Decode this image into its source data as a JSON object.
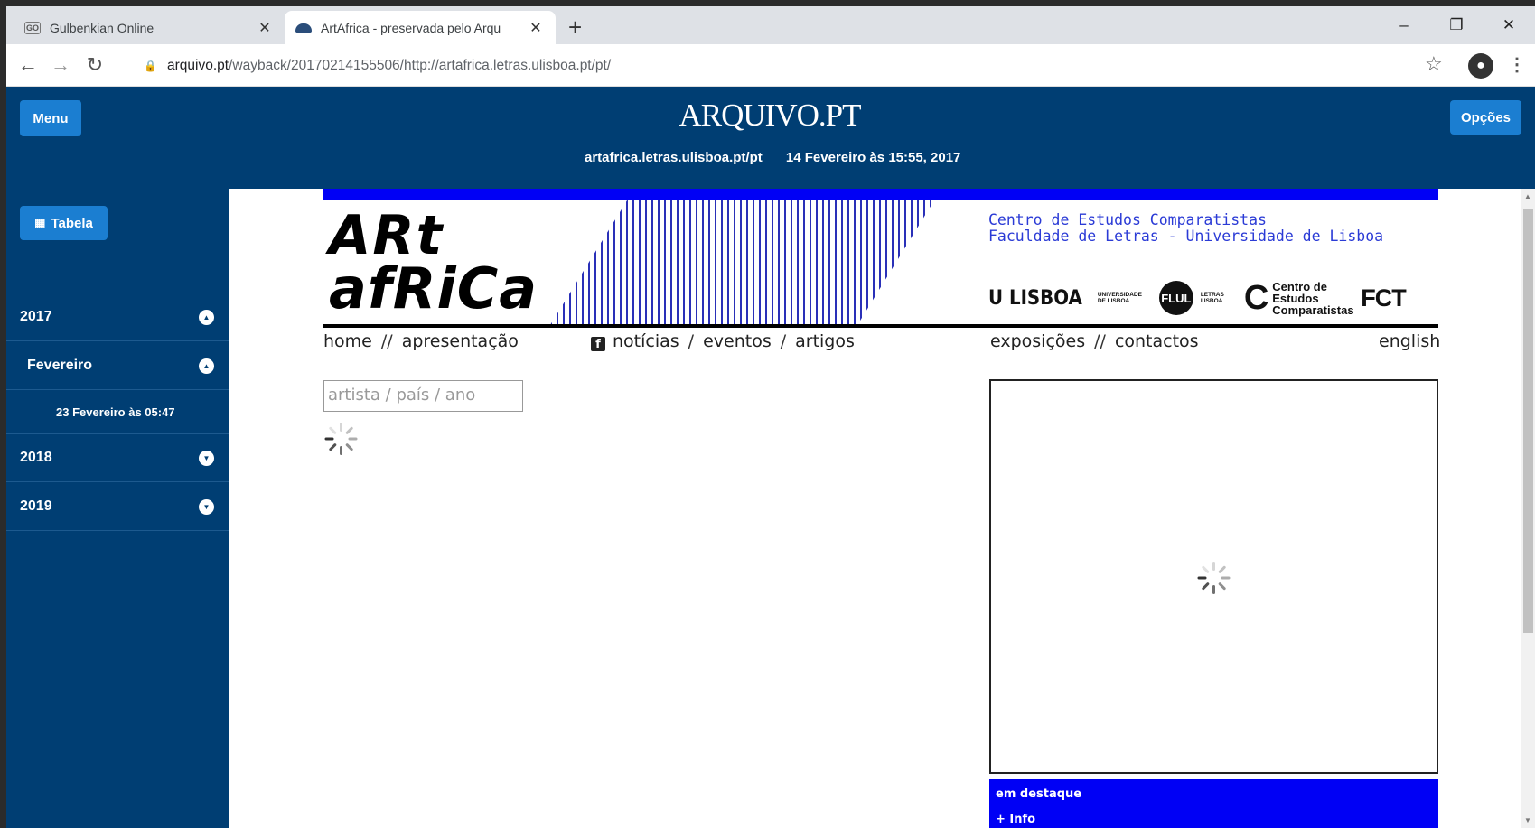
{
  "browser": {
    "tabs": [
      {
        "title": "Gulbenkian Online",
        "favicon": "GO",
        "active": false
      },
      {
        "title": "ArtAfrica - preservada pelo Arqu",
        "active": true
      }
    ],
    "new_tab": "+",
    "window_controls": {
      "minimize": "–",
      "restore": "❐",
      "close": "✕"
    },
    "url_host": "arquivo.pt",
    "url_path": "/wayback/20170214155506/http://artafrica.letras.ulisboa.pt/pt/"
  },
  "arquivo": {
    "menu_label": "Menu",
    "options_label": "Opções",
    "logo": "ARQUIVO.PT",
    "archived_link": "artafrica.letras.ulisboa.pt/pt",
    "archived_date": "14 Fevereiro às 15:55, 2017",
    "table_label": "Tabela",
    "timeline": [
      {
        "label": "2017",
        "expanded": true
      },
      {
        "label": "Fevereiro",
        "expanded": true
      },
      {
        "label": "23 Fevereiro às 05:47"
      },
      {
        "label": "2018",
        "expanded": false
      },
      {
        "label": "2019",
        "expanded": false
      }
    ]
  },
  "site": {
    "logo_line1": "ARt",
    "logo_line2": "afRiCa",
    "institution_line1": "Centro de Estudos Comparatistas",
    "institution_line2": "Faculdade de Letras - Universidade de Lisboa",
    "partner_logos": {
      "ulisboa": "U LISBOA",
      "ulisboa_small": "UNIVERSIDADE DE LISBOA",
      "flul": "FLUL",
      "flul_small": "LETRAS LISBOA",
      "cec": "Centro de Estudos Comparatistas",
      "fct": "FCT"
    },
    "nav": {
      "home": "home",
      "apresentacao": "apresentação",
      "noticias": "notícias",
      "eventos": "eventos",
      "artigos": "artigos",
      "exposicoes": "exposições",
      "contactos": "contactos",
      "english": "english"
    },
    "search_placeholder": "artista / país / ano",
    "destaque_title": "em destaque",
    "destaque_info": "+ Info"
  },
  "colors": {
    "arquivo_blue": "#003e73",
    "button_blue": "#1b7ed1",
    "site_accent": "#0000f5"
  }
}
